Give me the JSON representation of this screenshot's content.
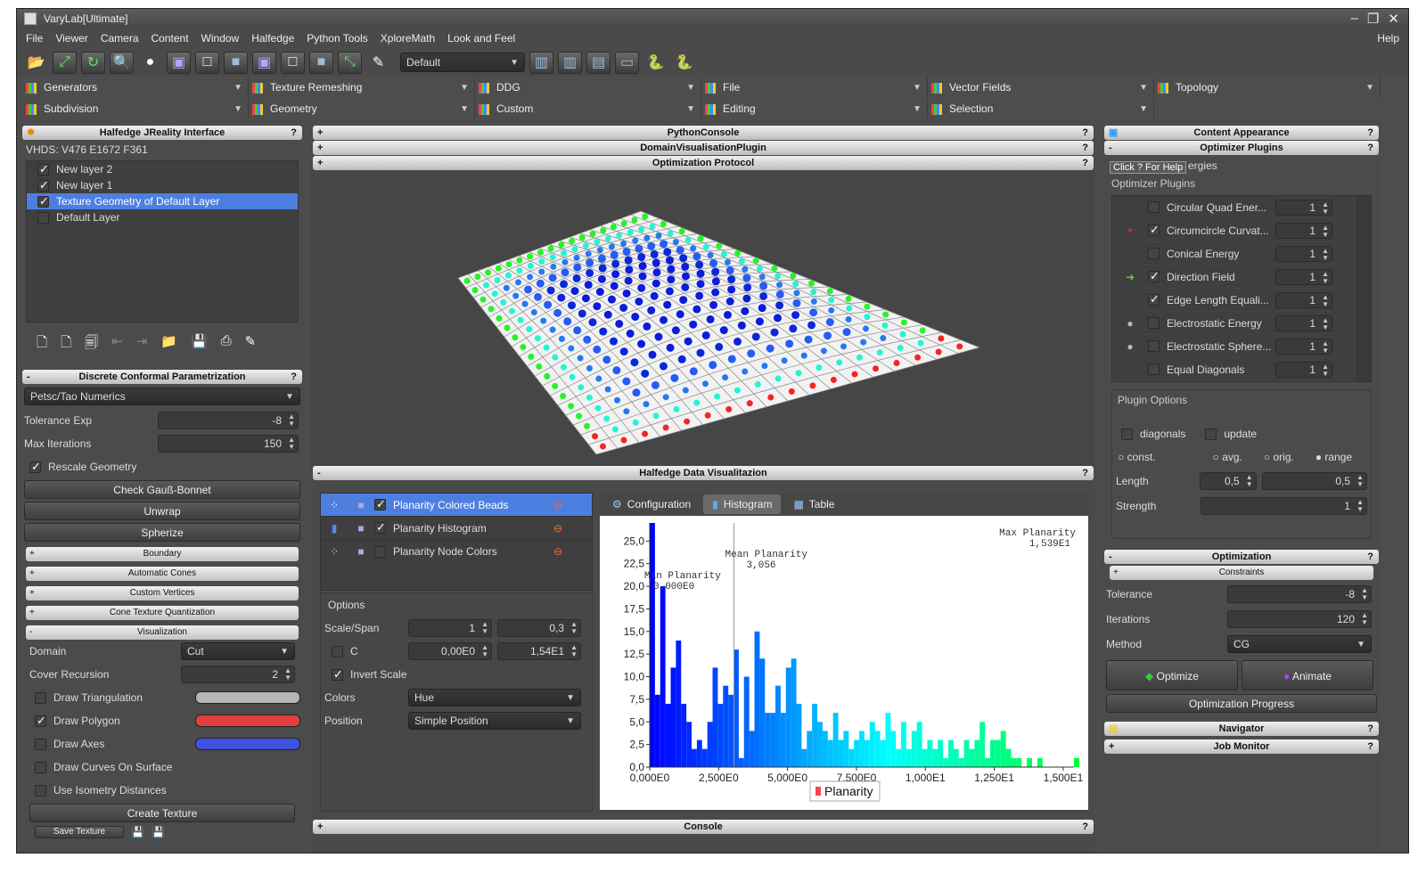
{
  "app": {
    "title": "VaryLab[Ultimate]"
  },
  "menu": {
    "items": [
      "File",
      "Viewer",
      "Camera",
      "Content",
      "Window",
      "Halfedge",
      "Python Tools",
      "XploreMath",
      "Look and Feel"
    ],
    "help": "Help"
  },
  "toolbar": {
    "scene_combo": "Default"
  },
  "categories": {
    "row1": [
      "Generators",
      "Texture Remeshing",
      "DDG",
      "File",
      "Vector Fields",
      "Topology"
    ],
    "row2": [
      "Subdivision",
      "Geometry",
      "Custom",
      "Editing",
      "Selection"
    ]
  },
  "left": {
    "title": "Halfedge JReality Interface",
    "vhds": "VHDS: V476 E1672 F361",
    "layers": [
      {
        "label": "New layer 2",
        "checked": true
      },
      {
        "label": "New layer 1",
        "checked": true
      },
      {
        "label": "Texture Geometry of Default Layer",
        "checked": true
      },
      {
        "label": "Default Layer",
        "checked": false
      }
    ],
    "dcp": {
      "title": "Discrete Conformal Parametrization",
      "numerics": "Petsc/Tao Numerics",
      "tol_label": "Tolerance Exp",
      "tol_val": "-8",
      "iter_label": "Max Iterations",
      "iter_val": "150",
      "rescale": "Rescale Geometry",
      "btn_gauss": "Check Gauß-Bonnet",
      "btn_unwrap": "Unwrap",
      "btn_spherize": "Spherize"
    },
    "sections": [
      "Boundary",
      "Automatic Cones",
      "Custom Vertices",
      "Cone Texture Quantization",
      "Visualization"
    ],
    "vis": {
      "domain_label": "Domain",
      "domain_val": "Cut",
      "cover_label": "Cover Recursion",
      "cover_val": "2",
      "draw_tri": "Draw Triangulation",
      "draw_poly": "Draw Polygon",
      "draw_axes": "Draw Axes",
      "draw_curves": "Draw Curves On Surface",
      "use_iso": "Use Isometry Distances",
      "create_tex": "Create Texture",
      "save_tex": "Save Texture",
      "color_tri": "#b5b5b5",
      "color_poly": "#e04040",
      "color_axes": "#4050e0"
    }
  },
  "center": {
    "python_console": "PythonConsole",
    "domain_vis": "DomainVisualisationPlugin",
    "opt_protocol": "Optimization Protocol",
    "hdv_title": "Halfedge Data Visualitazion",
    "console": "Console",
    "vis_items": [
      {
        "label": "Planarity Colored Beads",
        "checked": true
      },
      {
        "label": "Planarity Histogram",
        "checked": true
      },
      {
        "label": "Planarity Node Colors",
        "checked": false
      }
    ],
    "options": {
      "title": "Options",
      "scale_label": "Scale/Span",
      "scale_a": "1",
      "scale_b": "0,3",
      "c_label": "C",
      "c_a": "0,00E0",
      "c_b": "1,54E1",
      "invert": "Invert Scale",
      "colors_label": "Colors",
      "colors_val": "Hue",
      "position_label": "Position",
      "position_val": "Simple Position"
    },
    "tabs": [
      "Configuration",
      "Histogram",
      "Table"
    ]
  },
  "chart_data": {
    "type": "bar",
    "title": "",
    "xlabel": "",
    "ylabel": "",
    "xlim": [
      0,
      15.39
    ],
    "ylim": [
      0,
      27
    ],
    "x_ticks": [
      "0,000E0",
      "2,500E0",
      "5,000E0",
      "7,500E0",
      "1,000E1",
      "1,250E1",
      "1,500E1"
    ],
    "y_ticks": [
      "0,0",
      "2,5",
      "5,0",
      "7,5",
      "10,0",
      "12,5",
      "15,0",
      "17,5",
      "20,0",
      "22,5",
      "25,0"
    ],
    "legend": "Planarity",
    "annotations": {
      "min": "Min Planarity",
      "min_val": "0,000E0",
      "mean": "Mean Planarity",
      "mean_val": "3,056",
      "max": "Max Planarity",
      "max_val": "1,539E1"
    },
    "mean_x": 3.056,
    "bin_width": 0.19,
    "values": [
      27,
      8,
      20,
      7,
      11,
      14,
      7,
      5,
      2,
      3,
      2,
      5,
      11,
      7,
      9,
      8,
      13,
      1,
      10,
      4,
      15,
      12,
      6,
      6,
      9,
      6,
      11,
      12,
      7,
      2,
      4,
      7,
      5,
      4,
      3,
      6,
      3,
      4,
      2,
      3,
      4,
      3,
      5,
      4,
      3,
      6,
      4,
      2,
      5,
      2,
      4,
      5,
      2,
      3,
      2,
      3,
      1,
      3,
      2,
      1,
      3,
      2,
      3,
      5,
      1,
      3,
      3,
      4,
      2,
      1,
      1,
      0,
      1,
      0,
      1,
      0,
      0,
      0,
      0,
      0,
      0,
      1,
      0,
      0,
      0,
      0,
      0,
      0,
      0,
      0,
      1,
      0,
      0,
      1,
      0,
      0,
      1,
      1,
      0,
      0,
      0,
      0,
      0,
      0,
      0,
      0,
      0,
      0,
      0,
      0,
      1,
      0,
      0,
      0,
      0,
      0,
      0,
      0,
      0,
      0,
      0,
      0,
      0,
      0,
      0,
      0,
      0,
      0,
      0,
      0,
      0,
      0,
      0,
      1,
      0,
      0,
      0,
      0,
      0,
      0,
      1,
      0,
      0,
      0,
      0,
      0,
      0,
      0,
      0,
      0,
      0,
      0,
      0,
      0,
      0,
      0,
      0,
      0,
      0,
      0,
      0,
      0,
      0,
      0,
      0,
      0,
      0,
      0,
      0,
      0,
      0,
      0,
      0,
      0,
      0,
      0,
      0,
      0,
      0,
      0,
      1
    ]
  },
  "right": {
    "content_appearance": "Content Appearance",
    "optimizer_plugins": "Optimizer Plugins",
    "tooltip": "Click ? For Help",
    "energies": "ergies",
    "group_label": "Optimizer Plugins",
    "plugins": [
      {
        "label": "Circular Quad Ener...",
        "checked": false,
        "val": "1"
      },
      {
        "label": "Circumcircle Curvat...",
        "checked": true,
        "val": "1"
      },
      {
        "label": "Conical Energy",
        "checked": false,
        "val": "1"
      },
      {
        "label": "Direction Field",
        "checked": true,
        "val": "1"
      },
      {
        "label": "Edge Length Equali...",
        "checked": true,
        "val": "1"
      },
      {
        "label": "Electrostatic Energy",
        "checked": false,
        "val": "1"
      },
      {
        "label": "Electrostatic Sphere...",
        "checked": false,
        "val": "1"
      },
      {
        "label": "Equal Diagonals",
        "checked": false,
        "val": "1"
      }
    ],
    "plugin_options": "Plugin Options",
    "diagonals": "diagonals",
    "update": "update",
    "const": "const.",
    "avg": "avg.",
    "orig": "orig.",
    "range": "range",
    "length_label": "Length",
    "length_a": "0,5",
    "length_b": "0,5",
    "strength_label": "Strength",
    "strength_val": "1",
    "optimization": "Optimization",
    "constraints": "Constraints",
    "tol_label": "Tolerance",
    "tol_val": "-8",
    "iter_label": "Iterations",
    "iter_val": "120",
    "method_label": "Method",
    "method_val": "CG",
    "optimize": "Optimize",
    "animate": "Animate",
    "progress": "Optimization Progress",
    "navigator": "Navigator",
    "job_monitor": "Job Monitor"
  }
}
